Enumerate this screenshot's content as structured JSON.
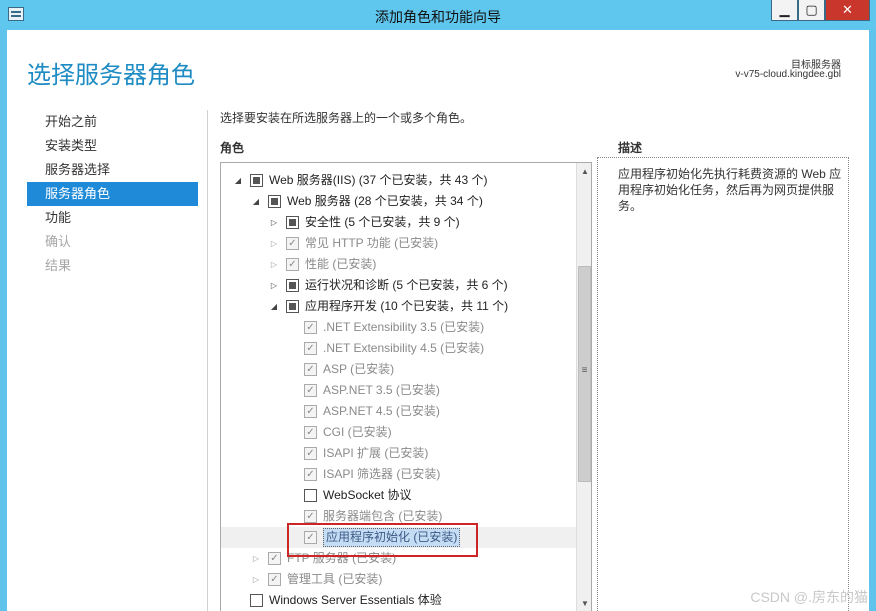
{
  "window": {
    "title": "添加角色和功能向导"
  },
  "window_buttons": {
    "minimize": "▁",
    "maximize": "▢",
    "close": "✕"
  },
  "page": {
    "title": "选择服务器角色",
    "target_label": "目标服务器",
    "target_server": "v-v75-cloud.kingdee.gbl",
    "instruction": "选择要安装在所选服务器上的一个或多个角色。",
    "roles_header": "角色",
    "description_header": "描述",
    "description": "应用程序初始化先执行耗费资源的 Web 应用程序初始化任务，然后再为网页提供服务。"
  },
  "nav": {
    "items": [
      {
        "label": "开始之前",
        "state": "normal"
      },
      {
        "label": "安装类型",
        "state": "normal"
      },
      {
        "label": "服务器选择",
        "state": "normal"
      },
      {
        "label": "服务器角色",
        "state": "active"
      },
      {
        "label": "功能",
        "state": "normal"
      },
      {
        "label": "确认",
        "state": "disabled"
      },
      {
        "label": "结果",
        "state": "disabled"
      }
    ]
  },
  "tree": {
    "rows": [
      {
        "label": "Web 服务器(IIS) (37 个已安装，共 43 个)",
        "level": 0,
        "expander": "expanded",
        "check": "partial",
        "dim": false
      },
      {
        "label": "Web 服务器 (28 个已安装，共 34 个)",
        "level": 1,
        "expander": "expanded",
        "check": "partial",
        "dim": false
      },
      {
        "label": "安全性 (5 个已安装，共 9 个)",
        "level": 2,
        "expander": "collapsed",
        "check": "partial",
        "dim": false
      },
      {
        "label": "常见 HTTP 功能 (已安装)",
        "level": 2,
        "expander": "collapsed",
        "check": "checked",
        "dim": true
      },
      {
        "label": "性能 (已安装)",
        "level": 2,
        "expander": "collapsed",
        "check": "checked",
        "dim": true
      },
      {
        "label": "运行状况和诊断 (5 个已安装，共 6 个)",
        "level": 2,
        "expander": "collapsed",
        "check": "partial",
        "dim": false
      },
      {
        "label": "应用程序开发 (10 个已安装，共 11 个)",
        "level": 2,
        "expander": "expanded",
        "check": "partial",
        "dim": false
      },
      {
        "label": ".NET Extensibility 3.5 (已安装)",
        "level": 3,
        "expander": "none",
        "check": "checked",
        "dim": true
      },
      {
        "label": ".NET Extensibility 4.5 (已安装)",
        "level": 3,
        "expander": "none",
        "check": "checked",
        "dim": true
      },
      {
        "label": "ASP (已安装)",
        "level": 3,
        "expander": "none",
        "check": "checked",
        "dim": true
      },
      {
        "label": "ASP.NET 3.5 (已安装)",
        "level": 3,
        "expander": "none",
        "check": "checked",
        "dim": true
      },
      {
        "label": "ASP.NET 4.5 (已安装)",
        "level": 3,
        "expander": "none",
        "check": "checked",
        "dim": true
      },
      {
        "label": "CGI (已安装)",
        "level": 3,
        "expander": "none",
        "check": "checked",
        "dim": true
      },
      {
        "label": "ISAPI 扩展 (已安装)",
        "level": 3,
        "expander": "none",
        "check": "checked",
        "dim": true
      },
      {
        "label": "ISAPI 筛选器 (已安装)",
        "level": 3,
        "expander": "none",
        "check": "checked",
        "dim": true
      },
      {
        "label": "WebSocket 协议",
        "level": 3,
        "expander": "none",
        "check": "unchecked",
        "dim": false
      },
      {
        "label": "服务器端包含 (已安装)",
        "level": 3,
        "expander": "none",
        "check": "checked",
        "dim": true
      },
      {
        "label": "应用程序初始化 (已安装)",
        "level": 3,
        "expander": "none",
        "check": "checked",
        "dim": true,
        "selected": true
      },
      {
        "label": "FTP 服务器 (已安装)",
        "level": 1,
        "expander": "collapsed",
        "check": "checked",
        "dim": true
      },
      {
        "label": "管理工具 (已安装)",
        "level": 1,
        "expander": "collapsed",
        "check": "checked",
        "dim": true
      },
      {
        "label": "Windows Server Essentials 体验",
        "level": 0,
        "expander": "none",
        "check": "unchecked",
        "dim": false
      }
    ]
  },
  "icons": {
    "expanded": "◢",
    "collapsed": "▷",
    "check": "✓",
    "grip": "≡",
    "scroll_up": "▲",
    "scroll_down": "▼"
  },
  "colors": {
    "title_bar": "#5fc6ee",
    "accent": "#1e8bc3",
    "nav_active": "#1f8bd8",
    "highlight_box": "#cc2525"
  },
  "watermark": "CSDN @.房东的猫"
}
